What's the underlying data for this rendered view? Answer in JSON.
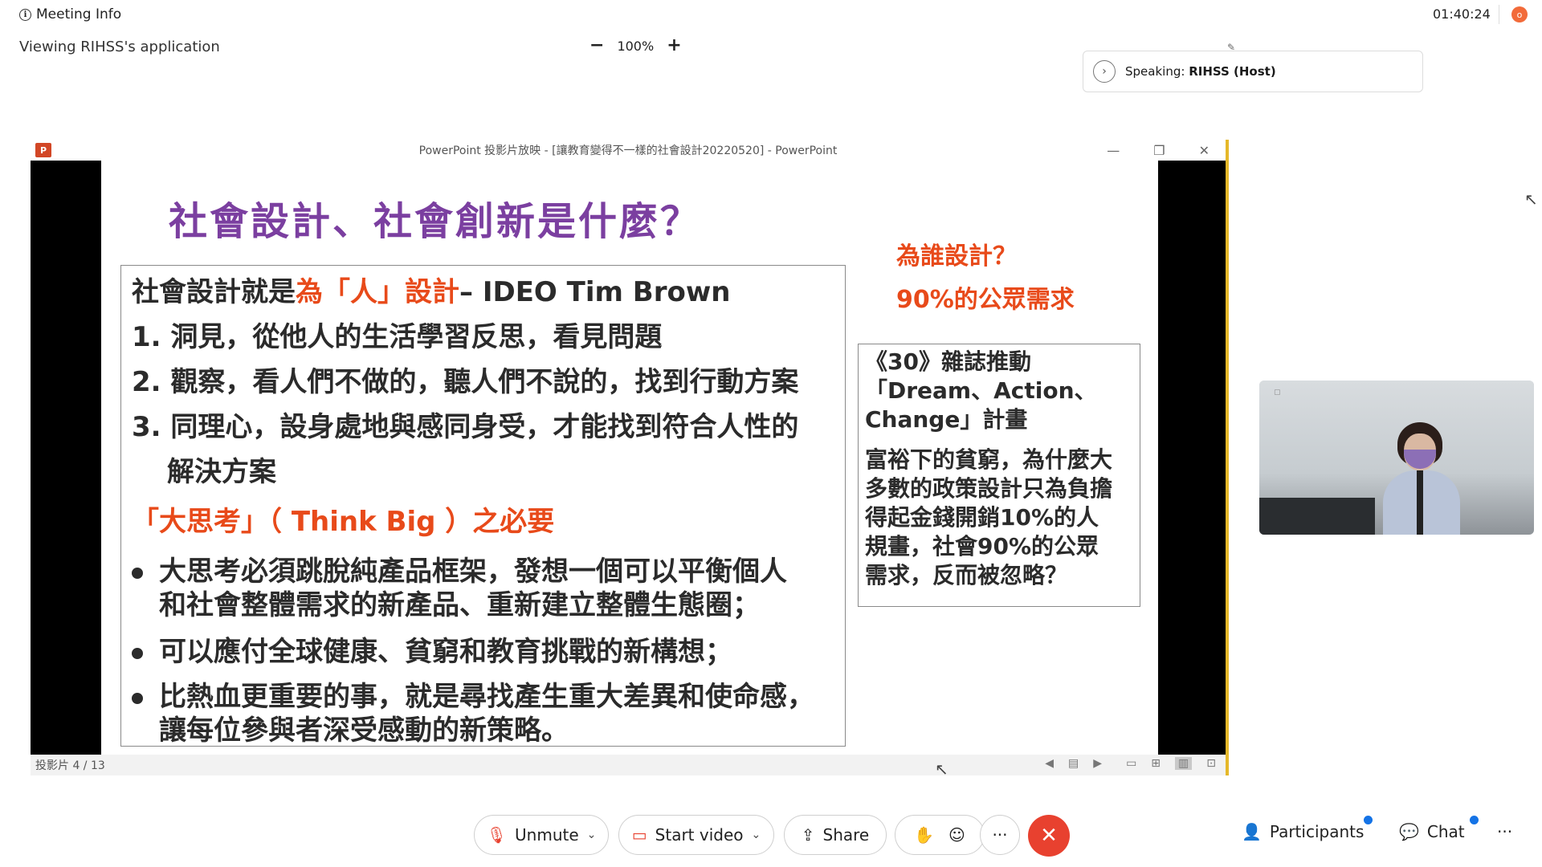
{
  "topbar": {
    "meeting_info": "Meeting Info",
    "clock": "01:40:24",
    "rec_label": "o"
  },
  "viewing": "Viewing RIHSS's application",
  "zoom": {
    "minus": "−",
    "level": "100%",
    "plus": "+"
  },
  "speaking": {
    "prefix": "Speaking:",
    "name": "RIHSS (Host)"
  },
  "share_window": {
    "title": "PowerPoint 投影片放映 - [讓教育變得不一樣的社會設計20220520] - PowerPoint",
    "logo": "P",
    "minimize": "—",
    "restore": "❐",
    "close": "✕",
    "status": "投影片 4 / 13"
  },
  "slide": {
    "title": "社會設計、社會創新是什麼？",
    "line1_a": "社會設計就是",
    "line1_b": "為「人」設計",
    "line1_c": "– IDEO  Tim Brown",
    "item1": "1. 洞見，從他人的生活學習反思，看見問題",
    "item2": "2. 觀察，看人們不做的，聽人們不說的，找到行動方案",
    "item3a": "3. 同理心，設身處地與感同身受，才能找到符合人性的",
    "item3b": "解決方案",
    "think_big": "「大思考」（ Think Big ）之必要",
    "b1a": "大思考必須跳脫純產品框架，發想一個可以平衡個人",
    "b1b": "和社會整體需求的新產品、重新建立整體生態圈；",
    "b2": "可以應付全球健康、貧窮和教育挑戰的新構想；",
    "b3a": "比熱血更重要的事，就是尋找產生重大差異和使命感，",
    "b3b": "讓每位參與者深受感動的新策略。",
    "side_q1": "為誰設計？",
    "side_q2": "90%的公眾需求",
    "side_1": "《30》雜誌推動",
    "side_2": "「Dream、Action、",
    "side_3": "Change」計畫",
    "side_4": "富裕下的貧窮，為什麼大",
    "side_5": "多數的政策設計只為負擔",
    "side_6": "得起金錢開銷10%的人",
    "side_7": "規畫，社會90%的公眾",
    "side_8": "需求，反而被忽略？"
  },
  "controls": {
    "unmute": "Unmute",
    "start_video": "Start video",
    "share": "Share",
    "more": "···",
    "participants": "Participants",
    "chat": "Chat",
    "overflow": "···"
  },
  "colors": {
    "end_call": "#e8412f",
    "slide_title": "#7b3fa0",
    "slide_red": "#e84a1a",
    "notify": "#1473e6"
  }
}
